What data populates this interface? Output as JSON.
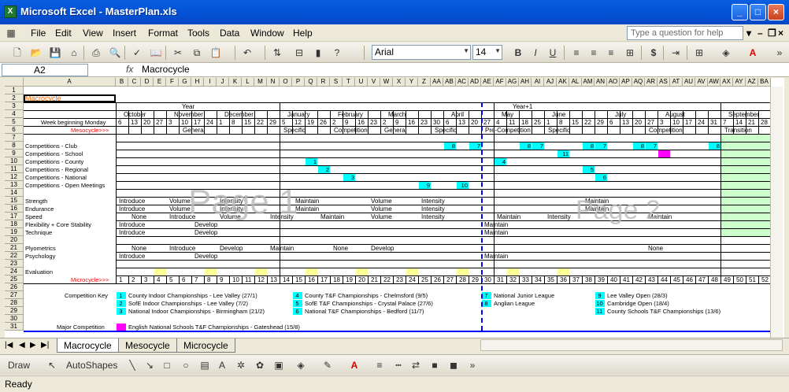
{
  "window": {
    "title": "Microsoft Excel - MasterPlan.xls",
    "app_icon": "excel-icon"
  },
  "menu": [
    "File",
    "Edit",
    "View",
    "Insert",
    "Format",
    "Tools",
    "Data",
    "Window",
    "Help"
  ],
  "help_placeholder": "Type a question for help",
  "font": {
    "name": "Arial",
    "size": "14"
  },
  "name_box": "A2",
  "formula": "Macrocycle",
  "columns": [
    "A",
    "B",
    "C",
    "D",
    "E",
    "F",
    "G",
    "H",
    "I",
    "J",
    "K",
    "L",
    "M",
    "N",
    "O",
    "P",
    "Q",
    "R",
    "S",
    "T",
    "U",
    "V",
    "W",
    "X",
    "Y",
    "Z",
    "AA",
    "AB",
    "AC",
    "AD",
    "AE",
    "AF",
    "AG",
    "AH",
    "AI",
    "AJ",
    "AK",
    "AL",
    "AM",
    "AN",
    "AO",
    "AP",
    "AQ",
    "AR",
    "AS",
    "AT",
    "AU",
    "AV",
    "AW",
    "AX",
    "AY",
    "AZ",
    "BA"
  ],
  "rows": [
    "1",
    "2",
    "3",
    "4",
    "5",
    "6",
    "7",
    "8",
    "9",
    "10",
    "11",
    "12",
    "13",
    "14",
    "15",
    "16",
    "17",
    "18",
    "19",
    "20",
    "21",
    "22",
    "23",
    "24",
    "25",
    "26",
    "27",
    "28",
    "29",
    "30",
    "31"
  ],
  "sheet": {
    "title": "Macrocycle",
    "year": "Year",
    "year1": "Year+1",
    "months": [
      "October",
      "November",
      "December",
      "January",
      "February",
      "March",
      "April",
      "May",
      "June",
      "July",
      "August",
      "September"
    ],
    "week_label": "Week beginning Monday",
    "weeks": [
      "6",
      "13",
      "20",
      "27",
      "3",
      "10",
      "17",
      "24",
      "1",
      "8",
      "15",
      "22",
      "29",
      "5",
      "12",
      "19",
      "26",
      "2",
      "9",
      "16",
      "23",
      "2",
      "9",
      "16",
      "23",
      "30",
      "6",
      "13",
      "20",
      "27",
      "4",
      "11",
      "18",
      "25",
      "1",
      "8",
      "15",
      "22",
      "29",
      "6",
      "13",
      "20",
      "27",
      "3",
      "10",
      "17",
      "24",
      "31",
      "7",
      "14",
      "21",
      "28"
    ],
    "mesocycle_label": "Mesocycle>>>",
    "mesocycles": [
      "General",
      "Specific",
      "Competition",
      "General",
      "Specific",
      "Pre-Competition",
      "Specific",
      "Competition",
      "Transition"
    ],
    "row_labels": [
      "Competitions - Club",
      "Competitions - School",
      "Competitions - County",
      "Competitions - Regional",
      "Competitions - National",
      "Competitions - Open Meetings",
      "Strength",
      "Endurance",
      "Speed",
      "Flexibility + Core Stability",
      "Technique",
      "Plyometrics",
      "Psychology",
      "Evaluation"
    ],
    "phase_words": {
      "introduce": "Introduce",
      "volume": "Volume",
      "intensity": "Intensity",
      "maintain": "Maintain",
      "develop": "Develop",
      "none": "None"
    },
    "comp_numbers": [
      "8",
      "7",
      "8",
      "7",
      "8",
      "7",
      "8",
      "7",
      "8",
      "11",
      "6",
      "1",
      "4",
      "2",
      "5",
      "3",
      "9",
      "10"
    ],
    "microcycle_label": "Microcycle>>>",
    "microcycles": [
      "1",
      "2",
      "3",
      "4",
      "5",
      "6",
      "7",
      "8",
      "9",
      "10",
      "11",
      "12",
      "13",
      "14",
      "15",
      "16",
      "17",
      "18",
      "19",
      "20",
      "21",
      "22",
      "23",
      "24",
      "25",
      "26",
      "27",
      "28",
      "29",
      "30",
      "31",
      "32",
      "33",
      "34",
      "35",
      "36",
      "37",
      "38",
      "39",
      "40",
      "41",
      "42",
      "43",
      "44",
      "45",
      "46",
      "47",
      "48",
      "49",
      "50",
      "51",
      "52"
    ],
    "key_label": "Competition Key",
    "key": [
      {
        "n": "1",
        "t": "County Indoor Championships - Lee Valley (27/1)"
      },
      {
        "n": "2",
        "t": "SofE Indoor Championships - Lee Valley (7/2)"
      },
      {
        "n": "3",
        "t": "National Indoor Championships - Birmingham (21/2)"
      },
      {
        "n": "4",
        "t": "County T&F Championships - Chelmsford (9/5)"
      },
      {
        "n": "5",
        "t": "SofE T&F Championships - Crystal Palace (27/6)"
      },
      {
        "n": "6",
        "t": "National T&F Championships - Bedford (11/7)"
      },
      {
        "n": "7",
        "t": "National Junior League"
      },
      {
        "n": "8",
        "t": "Anglian League"
      },
      {
        "n": "9",
        "t": "Lee Valley Open (28/3)"
      },
      {
        "n": "10",
        "t": "Cambridge Open (18/4)"
      },
      {
        "n": "11",
        "t": "County Schools T&F Championships (13/6)"
      }
    ],
    "major_label": "Major Competition",
    "major_text": "English National Schools T&F Championships - Gateshead (15/8)",
    "page1": "Page 1",
    "page2": "Page 2"
  },
  "tabs": [
    "Macrocycle",
    "Mesocycle",
    "Microcycle"
  ],
  "drawbar": {
    "draw": "Draw",
    "autoshapes": "AutoShapes"
  },
  "status": "Ready",
  "colors": {
    "cyan": "#00ffff",
    "magenta": "#ff00ff",
    "yellow": "#ffff99",
    "green": "#ccffcc",
    "mesocycle_red": "#ff0000",
    "title_orange": "#ff6600"
  }
}
